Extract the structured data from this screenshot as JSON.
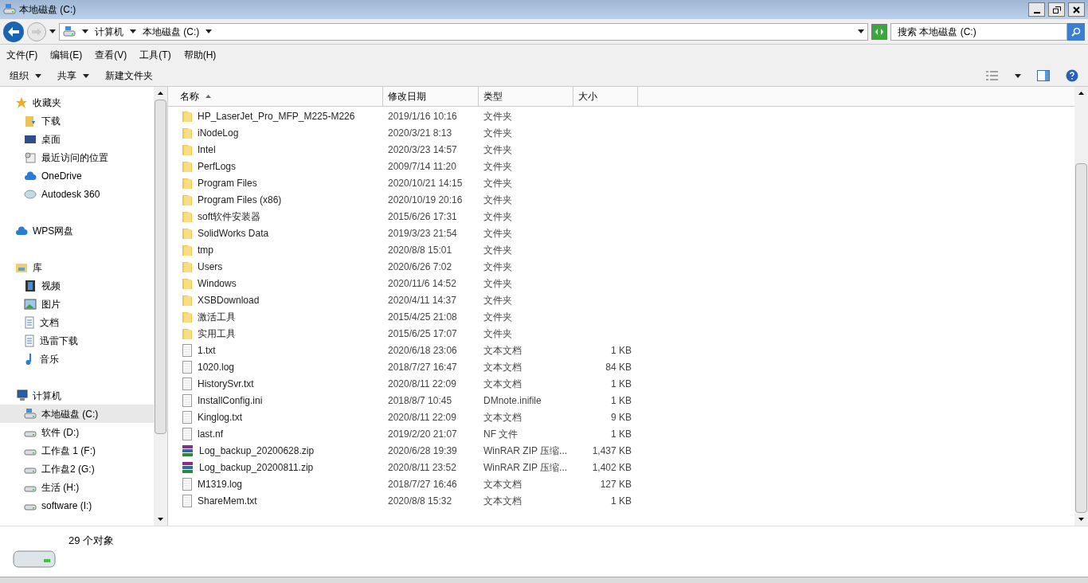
{
  "window": {
    "title": "本地磁盘 (C:)"
  },
  "address": {
    "crumbs": [
      "计算机",
      "本地磁盘 (C:)"
    ],
    "search_placeholder": "搜索 本地磁盘 (C:)"
  },
  "menu": [
    "文件(F)",
    "编辑(E)",
    "查看(V)",
    "工具(T)",
    "帮助(H)"
  ],
  "toolbar": [
    {
      "label": "组织",
      "dropdown": true
    },
    {
      "label": "共享",
      "dropdown": true
    },
    {
      "label": "新建文件夹",
      "dropdown": false
    }
  ],
  "sidebar": {
    "groups": [
      {
        "label": "收藏夹",
        "kind": "star",
        "children": [
          {
            "label": "下载",
            "kind": "download",
            "selected": false
          },
          {
            "label": "桌面",
            "kind": "desktop",
            "selected": false
          },
          {
            "label": "最近访问的位置",
            "kind": "recent",
            "selected": false
          },
          {
            "label": "OneDrive",
            "kind": "cloud",
            "selected": false
          },
          {
            "label": "Autodesk 360",
            "kind": "disc",
            "selected": false
          }
        ]
      },
      {
        "label": "WPS网盘",
        "kind": "cloud"
      },
      {
        "label": "库",
        "kind": "library",
        "children": [
          {
            "label": "视频",
            "kind": "video",
            "selected": false
          },
          {
            "label": "图片",
            "kind": "picture",
            "selected": false
          },
          {
            "label": "文档",
            "kind": "doc",
            "selected": false
          },
          {
            "label": "迅雷下载",
            "kind": "doc",
            "selected": false
          },
          {
            "label": "音乐",
            "kind": "music",
            "selected": false
          }
        ]
      },
      {
        "label": "计算机",
        "kind": "computer",
        "children": [
          {
            "label": "本地磁盘 (C:)",
            "kind": "sysdrive",
            "selected": true
          },
          {
            "label": "软件 (D:)",
            "kind": "drive",
            "selected": false
          },
          {
            "label": "工作盘 1 (F:)",
            "kind": "drive",
            "selected": false
          },
          {
            "label": "工作盘2 (G:)",
            "kind": "drive",
            "selected": false
          },
          {
            "label": "生活 (H:)",
            "kind": "drive",
            "selected": false
          },
          {
            "label": "software (I:)",
            "kind": "drive",
            "selected": false
          }
        ]
      }
    ]
  },
  "table": {
    "columns": [
      "名称",
      "修改日期",
      "类型",
      "大小"
    ],
    "rows": [
      {
        "kind": "folder",
        "name": "HP_LaserJet_Pro_MFP_M225-M226",
        "date": "2019/1/16 10:16",
        "type": "文件夹",
        "size": ""
      },
      {
        "kind": "folder",
        "name": "iNodeLog",
        "date": "2020/3/21 8:13",
        "type": "文件夹",
        "size": ""
      },
      {
        "kind": "folder",
        "name": "Intel",
        "date": "2020/3/23 14:57",
        "type": "文件夹",
        "size": ""
      },
      {
        "kind": "folder",
        "name": "PerfLogs",
        "date": "2009/7/14 11:20",
        "type": "文件夹",
        "size": ""
      },
      {
        "kind": "folder",
        "name": "Program Files",
        "date": "2020/10/21 14:15",
        "type": "文件夹",
        "size": ""
      },
      {
        "kind": "folder",
        "name": "Program Files (x86)",
        "date": "2020/10/19 20:16",
        "type": "文件夹",
        "size": ""
      },
      {
        "kind": "folder",
        "name": "soft软件安装器",
        "date": "2015/6/26 17:31",
        "type": "文件夹",
        "size": ""
      },
      {
        "kind": "folder",
        "name": "SolidWorks Data",
        "date": "2019/3/23 21:54",
        "type": "文件夹",
        "size": ""
      },
      {
        "kind": "folder",
        "name": "tmp",
        "date": "2020/8/8 15:01",
        "type": "文件夹",
        "size": ""
      },
      {
        "kind": "folder",
        "name": "Users",
        "date": "2020/6/26 7:02",
        "type": "文件夹",
        "size": ""
      },
      {
        "kind": "folder",
        "name": "Windows",
        "date": "2020/11/6 14:52",
        "type": "文件夹",
        "size": ""
      },
      {
        "kind": "folder",
        "name": "XSBDownload",
        "date": "2020/4/11 14:37",
        "type": "文件夹",
        "size": ""
      },
      {
        "kind": "folder",
        "name": "激活工具",
        "date": "2015/4/25 21:08",
        "type": "文件夹",
        "size": ""
      },
      {
        "kind": "folder",
        "name": "实用工具",
        "date": "2015/6/25 17:07",
        "type": "文件夹",
        "size": ""
      },
      {
        "kind": "text",
        "name": "1.txt",
        "date": "2020/6/18 23:06",
        "type": "文本文档",
        "size": "1 KB"
      },
      {
        "kind": "text",
        "name": "1020.log",
        "date": "2018/7/27 16:47",
        "type": "文本文档",
        "size": "84 KB"
      },
      {
        "kind": "text",
        "name": "HistorySvr.txt",
        "date": "2020/8/11 22:09",
        "type": "文本文档",
        "size": "1 KB"
      },
      {
        "kind": "text",
        "name": "InstallConfig.ini",
        "date": "2018/8/7 10:45",
        "type": "DMnote.inifile",
        "size": "1 KB"
      },
      {
        "kind": "text",
        "name": "Kinglog.txt",
        "date": "2020/8/11 22:09",
        "type": "文本文档",
        "size": "9 KB"
      },
      {
        "kind": "text",
        "name": "last.nf",
        "date": "2019/2/20 21:07",
        "type": "NF 文件",
        "size": "1 KB"
      },
      {
        "kind": "zip",
        "name": "Log_backup_20200628.zip",
        "date": "2020/6/28 19:39",
        "type": "WinRAR ZIP 压缩...",
        "size": "1,437 KB"
      },
      {
        "kind": "zip",
        "name": "Log_backup_20200811.zip",
        "date": "2020/8/11 23:52",
        "type": "WinRAR ZIP 压缩...",
        "size": "1,402 KB"
      },
      {
        "kind": "text",
        "name": "M1319.log",
        "date": "2018/7/27 16:46",
        "type": "文本文档",
        "size": "127 KB"
      },
      {
        "kind": "text",
        "name": "ShareMem.txt",
        "date": "2020/8/8 15:32",
        "type": "文本文档",
        "size": "1 KB"
      }
    ]
  },
  "details": {
    "count": "29 个对象"
  }
}
